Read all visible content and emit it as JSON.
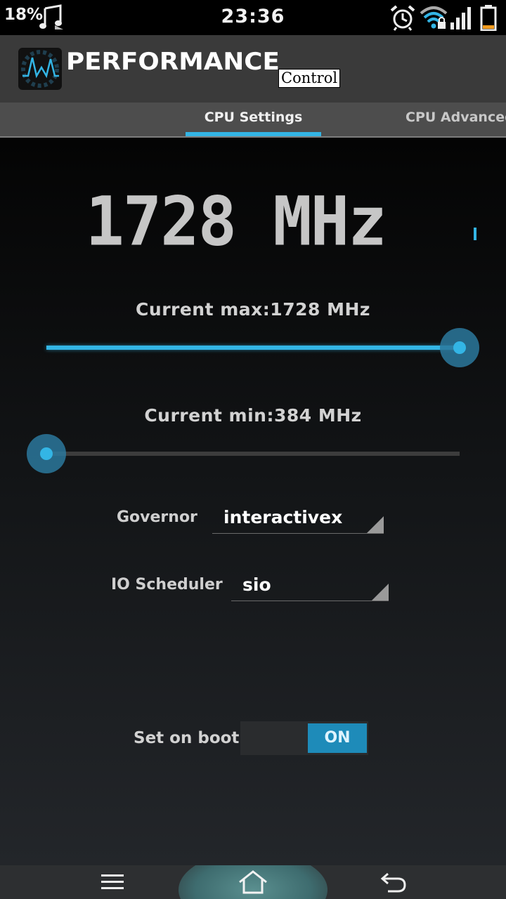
{
  "status_bar": {
    "battery_percent": "18%",
    "time": "23:36",
    "icons": [
      "music-note-icon",
      "alarm-clock-icon",
      "wifi-lock-icon",
      "signal-icon",
      "battery-icon"
    ]
  },
  "app_bar": {
    "title": "PERFORMANCE",
    "subtitle": "Control"
  },
  "tabs": [
    {
      "label": "CPU Settings",
      "active": true
    },
    {
      "label": "CPU Advanced",
      "active": false
    }
  ],
  "cpu": {
    "frequency": "1728 MHz",
    "max_label": "Current max:1728 MHz",
    "max_slider_fraction": 1.0,
    "min_label": "Current min:384 MHz",
    "min_slider_fraction": 0.0
  },
  "governor": {
    "label": "Governor",
    "value": "interactivex"
  },
  "io_scheduler": {
    "label": "IO Scheduler",
    "value": "sio"
  },
  "set_on_boot": {
    "label": "Set on boot",
    "state": "ON"
  },
  "colors": {
    "accent": "#33b5e5",
    "app_bar": "#3a3a3a",
    "tab_bar": "#4d4d4d"
  },
  "nav_bar": {
    "icons": [
      "menu-icon",
      "home-icon",
      "back-icon"
    ]
  }
}
